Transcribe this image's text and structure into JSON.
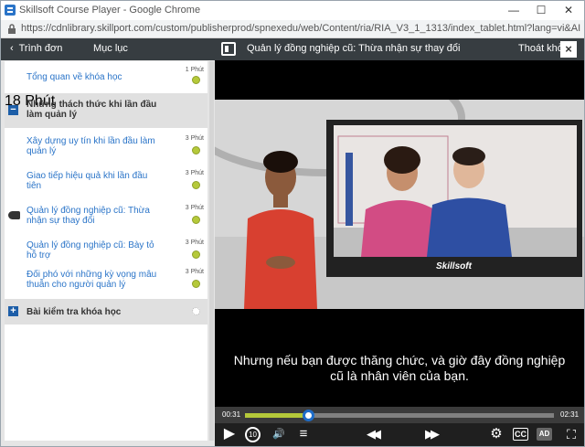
{
  "browser": {
    "window_title": "Skillsoft Course Player - Google Chrome",
    "url": "https://cdnlibrary.skillport.com/custom/publisherprod/spnexedu/web/Content/ria/RIA_V3_1_1313/index_tablet.html?lang=vi&AICC_URL=http..."
  },
  "left_panel": {
    "back_label": "Trình đơn",
    "title": "Mục lục",
    "items": [
      {
        "label": "Tổng quan về khóa học",
        "duration": "1 Phút"
      },
      {
        "label": "Những thách thức khi lần đầu làm quản lý",
        "duration": "18 Phút",
        "section_toggle": "−"
      },
      {
        "label": "Xây dựng uy tín khi lần đầu làm quản lý",
        "duration": "3 Phút"
      },
      {
        "label": "Giao tiếp hiệu quả khi lần đầu tiên",
        "duration": "3 Phút"
      },
      {
        "label": "Quản lý đồng nghiệp cũ: Thừa nhận sự thay đổi",
        "duration": "3 Phút"
      },
      {
        "label": "Quản lý đồng nghiệp cũ: Bày tỏ hỗ trợ",
        "duration": "3 Phút"
      },
      {
        "label": "Đối phó với những kỳ vọng mâu thuẫn cho người quản lý",
        "duration": "3 Phút"
      },
      {
        "label": "Bài kiểm tra khóa học",
        "section_toggle": "+"
      }
    ]
  },
  "player": {
    "title": "Quản lý đồng nghiệp cũ: Thừa nhận sự thay đổi",
    "exit_label": "Thoát khỏi",
    "close_label": "×",
    "video_logo": "Skillsoft",
    "caption_line1": "Nhưng nếu bạn được thăng chức, và giờ đây đồng nghiệp",
    "caption_line2": "cũ là nhân viên của bạn.",
    "time_current": "00:31",
    "time_total": "02:31",
    "progress_fraction": 0.205,
    "controls": {
      "play": "▶",
      "replay": "10",
      "volume": "🔊",
      "transcript": "≡",
      "rewind": "◀◀",
      "forward": "▶▶",
      "settings": "⚙",
      "cc": "CC",
      "ad": "AD",
      "fullscreen": "⛶"
    }
  },
  "colors": {
    "accent_blue": "#1d6cc8",
    "link_blue": "#2a74c8",
    "progress_green": "#b5c93a",
    "header_dark": "#373d41"
  }
}
